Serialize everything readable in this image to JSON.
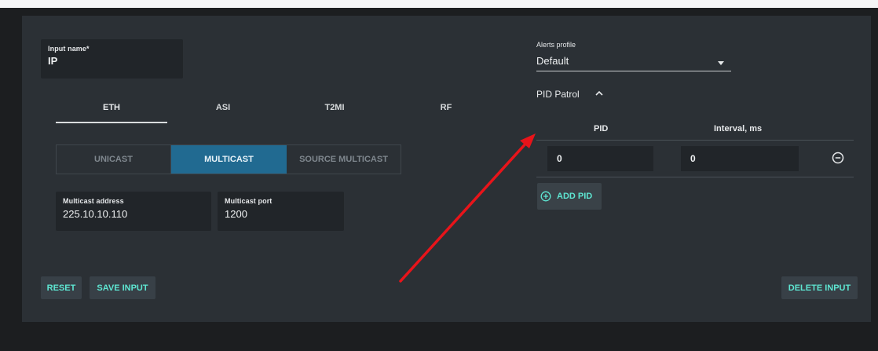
{
  "input_name": {
    "label": "Input name",
    "required_mark": "*",
    "value": "IP"
  },
  "tabs": [
    {
      "label": "ETH",
      "active": true
    },
    {
      "label": "ASI",
      "active": false
    },
    {
      "label": "T2MI",
      "active": false
    },
    {
      "label": "RF",
      "active": false
    }
  ],
  "cast_modes": [
    {
      "label": "UNICAST",
      "selected": false
    },
    {
      "label": "MULTICAST",
      "selected": true
    },
    {
      "label": "SOURCE MULTICAST",
      "selected": false
    }
  ],
  "multicast_address": {
    "label": "Multicast address",
    "value": "225.10.10.110"
  },
  "multicast_port": {
    "label": "Multicast port",
    "value": "1200"
  },
  "alerts_profile": {
    "label": "Alerts profile",
    "value": "Default",
    "caret_icon": "caret-down-icon"
  },
  "pid_patrol": {
    "title": "PID Patrol",
    "toggle_icon": "chevron-up-icon",
    "columns": {
      "pid": "PID",
      "interval": "Interval, ms"
    },
    "rows": [
      {
        "pid": "0",
        "interval": "0"
      }
    ],
    "remove_icon": "minus-circle-icon",
    "add_label": "ADD PID",
    "add_icon": "plus-circle-icon"
  },
  "buttons": {
    "reset": "RESET",
    "save": "SAVE INPUT",
    "delete": "DELETE INPUT"
  },
  "colors": {
    "accent": "#5ee6d2",
    "selected_segment": "#216a91",
    "panel": "#2b3035",
    "annotation_arrow": "#e8141a"
  }
}
